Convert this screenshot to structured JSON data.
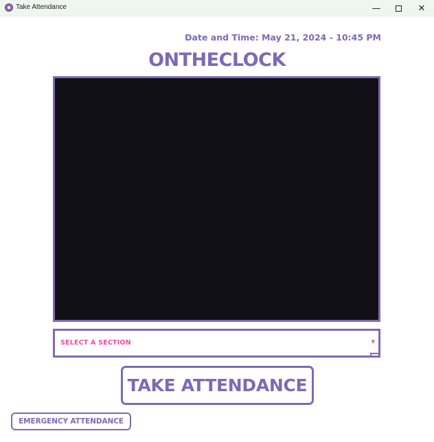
{
  "window": {
    "title": "Take Attendance",
    "controls": {
      "minimize": "—",
      "close": "✕"
    }
  },
  "header": {
    "datetime": "Date and Time: May 21, 2024 - 10:45 PM",
    "brand": "ONTHECLOCK"
  },
  "camera": {
    "state": "blank"
  },
  "section_select": {
    "selected": "SELECT A SECTION",
    "arrow": "▼"
  },
  "actions": {
    "take_attendance": "TAKE ATTENDANCE",
    "emergency_attendance": "EMERGENCY ATTENDANCE"
  },
  "colors": {
    "accent": "#7c6ab4",
    "select_text": "#f04da0",
    "camera_bg": "#111016",
    "titlebar_bg": "#eef6ef"
  }
}
